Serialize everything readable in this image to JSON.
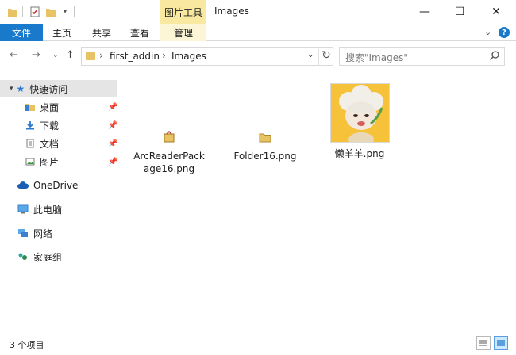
{
  "window": {
    "title": "Images",
    "context_tab": "图片工具",
    "buttons": {
      "minimize": "—",
      "maximize": "☐",
      "close": "✕"
    }
  },
  "ribbon": {
    "file": "文件",
    "tabs": [
      "主页",
      "共享",
      "查看"
    ],
    "manage": "管理"
  },
  "address": {
    "crumbs": [
      "first_addin",
      "Images"
    ],
    "search_placeholder": "搜索\"Images\""
  },
  "sidebar": {
    "quick_access": "快速访问",
    "pinned": [
      {
        "label": "桌面",
        "icon": "desktop-folder-icon"
      },
      {
        "label": "下载",
        "icon": "download-folder-icon"
      },
      {
        "label": "文档",
        "icon": "documents-folder-icon"
      },
      {
        "label": "图片",
        "icon": "pictures-folder-icon"
      }
    ],
    "onedrive": "OneDrive",
    "this_pc": "此电脑",
    "network": "网络",
    "homegroup": "家庭组"
  },
  "files": [
    {
      "name": "ArcReaderPackage16.png",
      "name_line1": "ArcReaderPack",
      "name_line2": "age16.png",
      "icon": "package-icon"
    },
    {
      "name": "Folder16.png",
      "icon": "folder-icon"
    },
    {
      "name": "懒羊羊.png",
      "icon": "sheep-thumbnail"
    }
  ],
  "status": {
    "count": "3 个项目"
  },
  "colors": {
    "accent": "#1979ca",
    "context_tab": "#f8e8a0",
    "selected": "#e5e5e5"
  }
}
